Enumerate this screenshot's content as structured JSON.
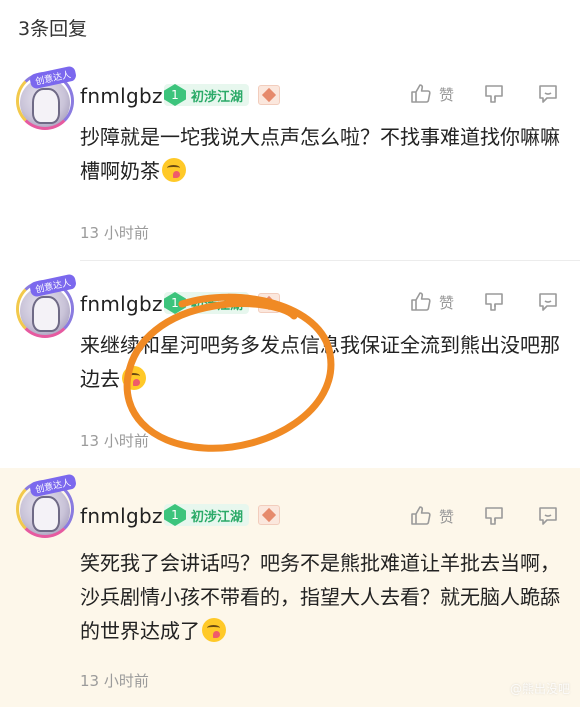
{
  "header": {
    "reply_count_label": "3条回复"
  },
  "icons": {
    "like": "thumbs-up-icon",
    "dislike": "thumbs-down-icon",
    "reply": "chat-bubble-icon",
    "level": "gem-icon",
    "badge": "diamond-badge-icon"
  },
  "colors": {
    "level_green": "#2aaa68",
    "highlight_bg": "#fdf7ea",
    "annotation_orange": "#f08a24"
  },
  "comments": [
    {
      "avatar_tag": "创意达人",
      "username": "fnmlgbz",
      "level_number": "1",
      "level_name": "初涉江湖",
      "like_label": "赞",
      "text": "抄障就是一坨我说大点声怎么啦？不找事难道找你嘛嘛槽啊奶茶",
      "time": "13 小时前"
    },
    {
      "avatar_tag": "创意达人",
      "username": "fnmlgbz",
      "level_number": "1",
      "level_name": "初涉江湖",
      "like_label": "赞",
      "text": "来继续和星河吧务多发点信息我保证全流到熊出没吧那边去",
      "time": "13 小时前"
    },
    {
      "avatar_tag": "创意达人",
      "username": "fnmlgbz",
      "level_number": "1",
      "level_name": "初涉江湖",
      "like_label": "赞",
      "text": "笑死我了会讲话吗？吧务不是熊批难道让羊批去当啊，沙兵剧情小孩不带看的，指望大人去看？就无脑人跪舔的世界达成了",
      "time": "13 小时前"
    }
  ],
  "watermark": "@熊出没吧"
}
